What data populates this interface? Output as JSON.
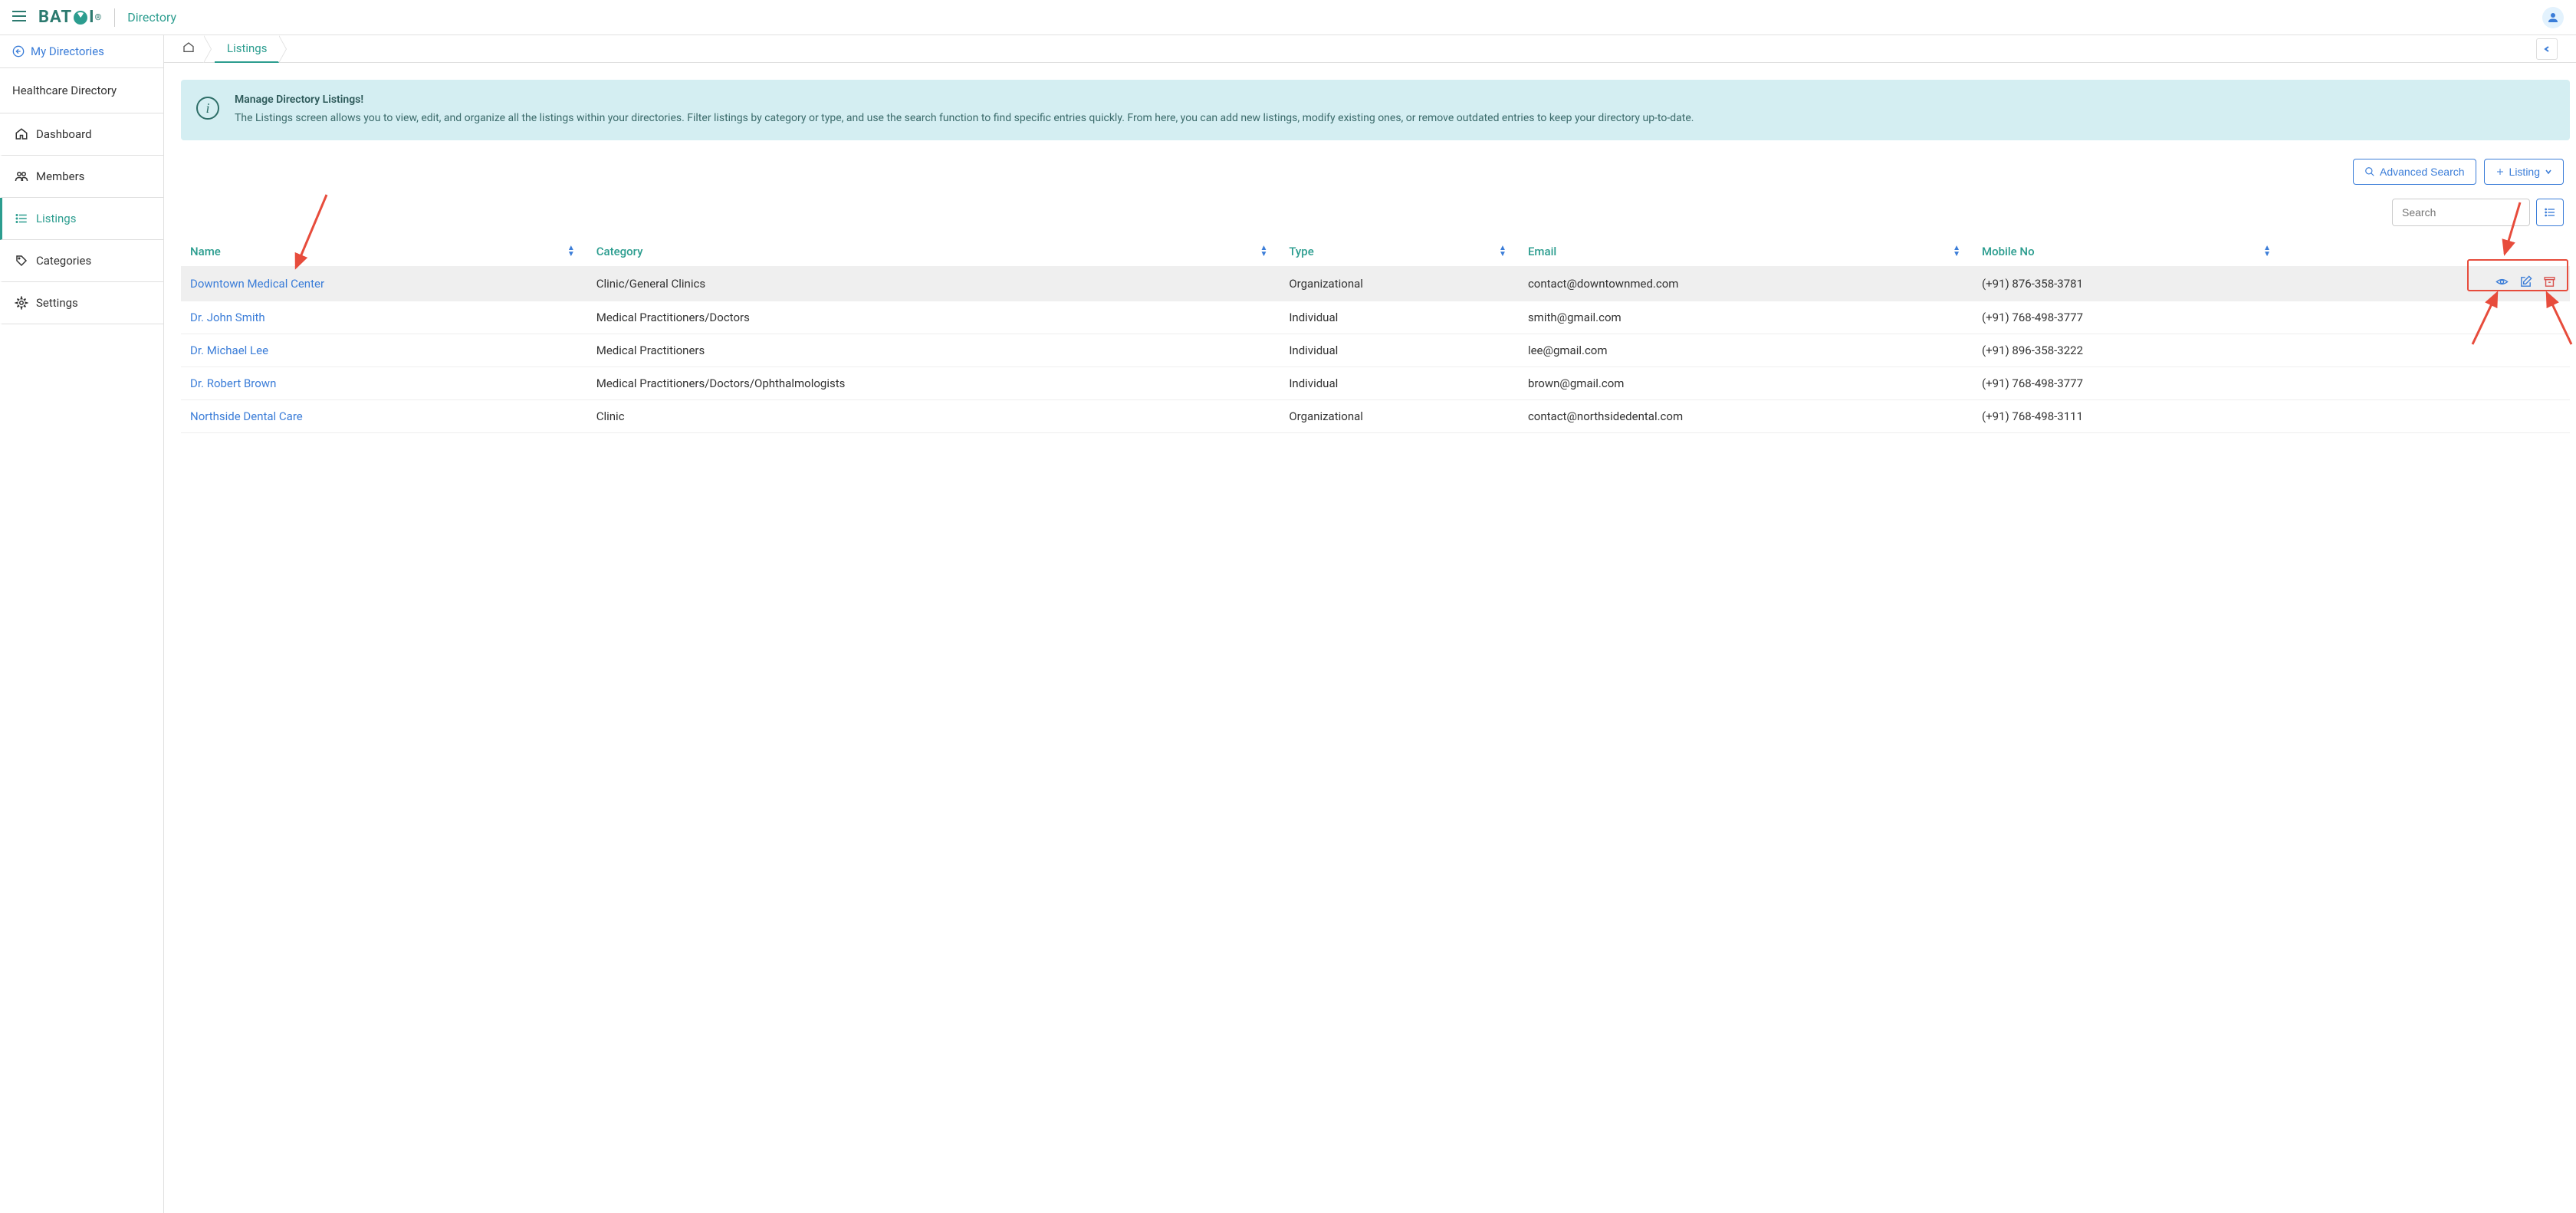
{
  "header": {
    "logo_text": "BAT",
    "logo_text2": "I",
    "logo_reg": "®",
    "app_name": "Directory"
  },
  "sidebar": {
    "back_label": "My Directories",
    "directory_title": "Healthcare Directory",
    "items": [
      {
        "label": "Dashboard",
        "icon": "home"
      },
      {
        "label": "Members",
        "icon": "members"
      },
      {
        "label": "Listings",
        "icon": "list",
        "active": true
      },
      {
        "label": "Categories",
        "icon": "tag"
      },
      {
        "label": "Settings",
        "icon": "gear"
      }
    ]
  },
  "breadcrumb": {
    "current": "Listings"
  },
  "info": {
    "title": "Manage Directory Listings!",
    "text": "The Listings screen allows you to view, edit, and organize all the listings within your directories. Filter listings by category or type, and use the search function to find specific entries quickly. From here, you can add new listings, modify existing ones, or remove outdated entries to keep your directory up-to-date."
  },
  "actions": {
    "advanced_search": "Advanced Search",
    "add_listing": "Listing"
  },
  "search": {
    "placeholder": "Search"
  },
  "table": {
    "columns": {
      "name": "Name",
      "category": "Category",
      "type": "Type",
      "email": "Email",
      "mobile": "Mobile No"
    },
    "rows": [
      {
        "name": "Downtown Medical Center",
        "category": "Clinic/General Clinics",
        "type": "Organizational",
        "email": "contact@downtownmed.com",
        "mobile": "(+91) 876-358-3781",
        "highlight": true,
        "actions": true
      },
      {
        "name": "Dr. John Smith",
        "category": "Medical Practitioners/Doctors",
        "type": "Individual",
        "email": "smith@gmail.com",
        "mobile": "(+91) 768-498-3777"
      },
      {
        "name": "Dr. Michael Lee",
        "category": "Medical Practitioners",
        "type": "Individual",
        "email": "lee@gmail.com",
        "mobile": "(+91) 896-358-3222"
      },
      {
        "name": "Dr. Robert Brown",
        "category": "Medical Practitioners/Doctors/Ophthalmologists",
        "type": "Individual",
        "email": "brown@gmail.com",
        "mobile": "(+91) 768-498-3777"
      },
      {
        "name": "Northside Dental Care",
        "category": "Clinic",
        "type": "Organizational",
        "email": "contact@northsidedental.com",
        "mobile": "(+91) 768-498-3111"
      }
    ]
  }
}
